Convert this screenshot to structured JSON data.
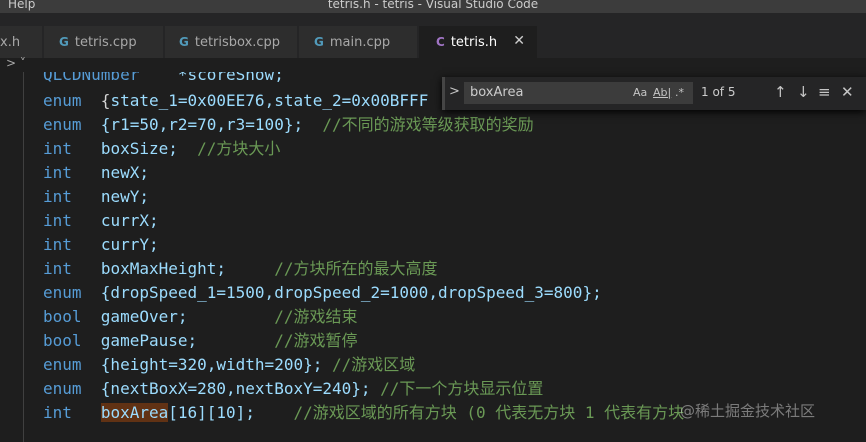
{
  "window": {
    "menu_item": "Help",
    "title": "tetris.h - tetris - Visual Studio Code"
  },
  "tabs": [
    {
      "icon": "",
      "label": "x.h",
      "active": false
    },
    {
      "icon": "G",
      "label": "tetris.cpp",
      "active": false
    },
    {
      "icon": "G",
      "label": "tetrisbox.cpp",
      "active": false
    },
    {
      "icon": "G",
      "label": "main.cpp",
      "active": false
    },
    {
      "icon": "C",
      "label": "tetris.h",
      "active": true
    }
  ],
  "tab_close_glyph": "✕",
  "breadcrumb": "> ˅",
  "editor": {
    "line0_var": "QLCDNumber",
    "line0_name": "*scoreShow;",
    "line1": {
      "kw": "enum",
      "open": "{",
      "text": "state_1=0x00EE76,state_2=0x00BFFF"
    },
    "line2": {
      "kw": "enum",
      "text": "{r1=50,r2=70,r3=100};",
      "comment": "//不同的游戏等级获取的奖励"
    },
    "line3": {
      "kw": "int",
      "name": "boxSize;",
      "comment": "//方块大小"
    },
    "line4": {
      "kw": "int",
      "name": "newX;"
    },
    "line5": {
      "kw": "int",
      "name": "newY;"
    },
    "line6": {
      "kw": "int",
      "name": "currX;"
    },
    "line7": {
      "kw": "int",
      "name": "currY;"
    },
    "line8": {
      "kw": "int",
      "name": "boxMaxHeight;",
      "comment": "//方块所在的最大高度"
    },
    "line9": {
      "kw": "enum",
      "text": "{dropSpeed_1=1500,dropSpeed_2=1000,dropSpeed_3=800};"
    },
    "line10": {
      "kw": "bool",
      "name": "gameOver;",
      "comment": "//游戏结束"
    },
    "line11": {
      "kw": "bool",
      "name": "gamePause;",
      "comment": "//游戏暂停"
    },
    "line12": {
      "kw": "enum",
      "text": "{height=320,width=200};",
      "comment": "//游戏区域"
    },
    "line13": {
      "kw": "enum",
      "text": "{nextBoxX=280,nextBoxY=240};",
      "comment": "//下一个方块显示位置"
    },
    "line14": {
      "kw": "int",
      "name": "boxArea",
      "rest": "[16][10];",
      "comment": "//游戏区域的所有方块 (0 代表无方块 1 代表有方块"
    }
  },
  "find_widget": {
    "query": "boxArea",
    "match_case": "Aa",
    "whole_word": "Ab|",
    "regex": ".*",
    "result_count": "1 of 5",
    "prev_glyph": "↑",
    "next_glyph": "↓",
    "selection_glyph": "≡",
    "close_glyph": "✕",
    "toggle_glyph": ">"
  },
  "watermark": "@稀土掘金技术社区"
}
